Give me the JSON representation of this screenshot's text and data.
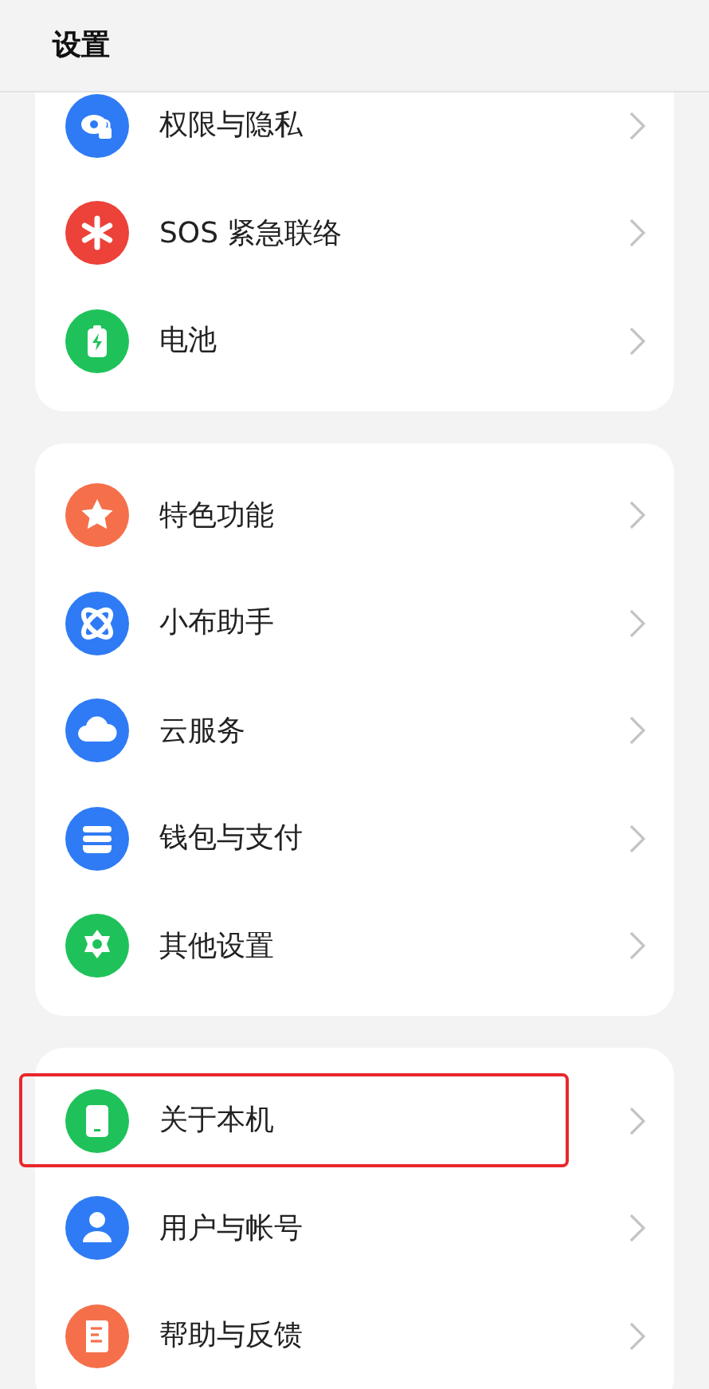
{
  "header": {
    "title": "设置"
  },
  "groups": [
    {
      "items": [
        {
          "label": "权限与隐私",
          "color": "#2f7bf5",
          "highlighted": false
        },
        {
          "label": "SOS 紧急联络",
          "color": "#ec4239",
          "highlighted": false
        },
        {
          "label": "电池",
          "color": "#1fc25a",
          "highlighted": false
        }
      ]
    },
    {
      "items": [
        {
          "label": "特色功能",
          "color": "#f5704a",
          "highlighted": false
        },
        {
          "label": "小布助手",
          "color": "#2f7bf5",
          "highlighted": false
        },
        {
          "label": "云服务",
          "color": "#2f7bf5",
          "highlighted": false
        },
        {
          "label": "钱包与支付",
          "color": "#2f7bf5",
          "highlighted": false
        },
        {
          "label": "其他设置",
          "color": "#1fc25a",
          "highlighted": false
        }
      ]
    },
    {
      "items": [
        {
          "label": "关于本机",
          "color": "#1fc25a",
          "highlighted": true
        },
        {
          "label": "用户与帐号",
          "color": "#2f7bf5",
          "highlighted": false
        },
        {
          "label": "帮助与反馈",
          "color": "#f5704a",
          "highlighted": false
        }
      ]
    }
  ]
}
